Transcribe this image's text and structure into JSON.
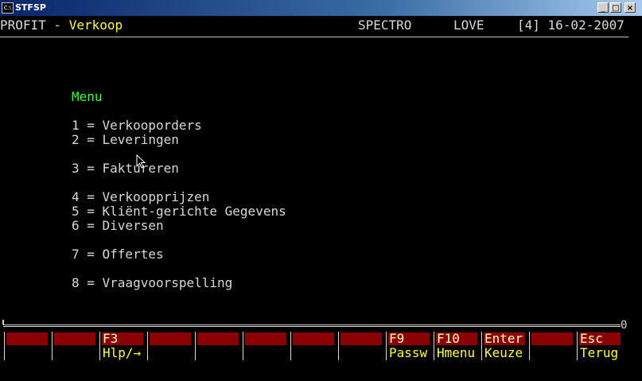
{
  "window": {
    "title": "STFSP",
    "icon_text": "C:\\",
    "minimize_glyph": "_",
    "maximize_glyph": "□",
    "close_glyph": "×"
  },
  "header": {
    "app": "PROFIT - ",
    "module": "Verkoop",
    "company": "SPECTRO",
    "user": "LOVE",
    "session_date": "[4] 16-02-2007"
  },
  "menu": {
    "title": "Menu",
    "items": [
      {
        "text": "1 = Verkooporders"
      },
      {
        "text": "2 = Leveringen"
      },
      {
        "text": "3 = Faktureren"
      },
      {
        "text": "4 = Verkoopprijzen"
      },
      {
        "text": "5 = Kliënt-gerichte Gegevens"
      },
      {
        "text": "6 = Diversen"
      },
      {
        "text": "7 = Offertes"
      },
      {
        "text": "8 = Vraagvoorspelling"
      }
    ]
  },
  "scroll": {
    "end_marker": "0"
  },
  "function_keys": [
    {
      "key": "",
      "label": ""
    },
    {
      "key": "",
      "label": ""
    },
    {
      "key": "F3",
      "label": "Hlp/→"
    },
    {
      "key": "",
      "label": ""
    },
    {
      "key": "",
      "label": ""
    },
    {
      "key": "",
      "label": ""
    },
    {
      "key": "",
      "label": ""
    },
    {
      "key": "",
      "label": ""
    },
    {
      "key": "F9",
      "label": "Passw"
    },
    {
      "key": "F10",
      "label": "Hmenu"
    },
    {
      "key": "Enter",
      "label": "Keuze"
    },
    {
      "key": "",
      "label": ""
    },
    {
      "key": "Esc",
      "label": "Terug"
    }
  ],
  "colors": {
    "key_bar": "#8b0000",
    "module_text": "#ffff40",
    "menu_title": "#40ff40"
  }
}
